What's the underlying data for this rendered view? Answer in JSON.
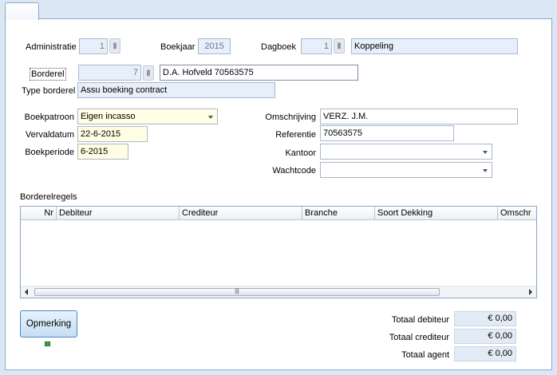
{
  "header": {
    "administratie_label": "Administratie",
    "administratie_value": "1",
    "boekjaar_label": "Boekjaar",
    "boekjaar_value": "2015",
    "dagboek_label": "Dagboek",
    "dagboek_value": "1",
    "dagboek_name": "Koppeling"
  },
  "borderel": {
    "label": "Borderel",
    "number": "7",
    "description": "D.A. Hofveld 70563575",
    "type_label": "Type borderel",
    "type_value": "Assu boeking contract"
  },
  "left_form": {
    "boekpatroon_label": "Boekpatroon",
    "boekpatroon_value": "Eigen incasso",
    "vervaldatum_label": "Vervaldatum",
    "vervaldatum_value": "22-6-2015",
    "boekperiode_label": "Boekperiode",
    "boekperiode_value": "6-2015"
  },
  "right_form": {
    "omschrijving_label": "Omschrijving",
    "omschrijving_value": "VERZ. J.M.",
    "referentie_label": "Referentie",
    "referentie_value": "70563575",
    "kantoor_label": "Kantoor",
    "kantoor_value": "",
    "wachtcode_label": "Wachtcode",
    "wachtcode_value": ""
  },
  "regels": {
    "title": "Borderelregels",
    "columns": [
      "Nr",
      "Debiteur",
      "Crediteur",
      "Branche",
      "Soort Dekking",
      "Omschr"
    ],
    "rows": []
  },
  "buttons": {
    "opmerking": "Opmerking"
  },
  "totals": {
    "debiteur_label": "Totaal debiteur",
    "debiteur_value": "€ 0,00",
    "crediteur_label": "Totaal crediteur",
    "crediteur_value": "€ 0,00",
    "agent_label": "Totaal agent",
    "agent_value": "€ 0,00"
  },
  "colors": {
    "background": "#dbe7f5",
    "readonly_field": "#e7effa",
    "required_field": "#fffde2",
    "button_border": "#4f86c4",
    "indicator": "#3aa34a"
  },
  "icons": {
    "lock": "lock-icon",
    "dropdown": "chevron-down-icon",
    "scroll_left": "arrow-left-icon",
    "scroll_right": "arrow-right-icon"
  }
}
